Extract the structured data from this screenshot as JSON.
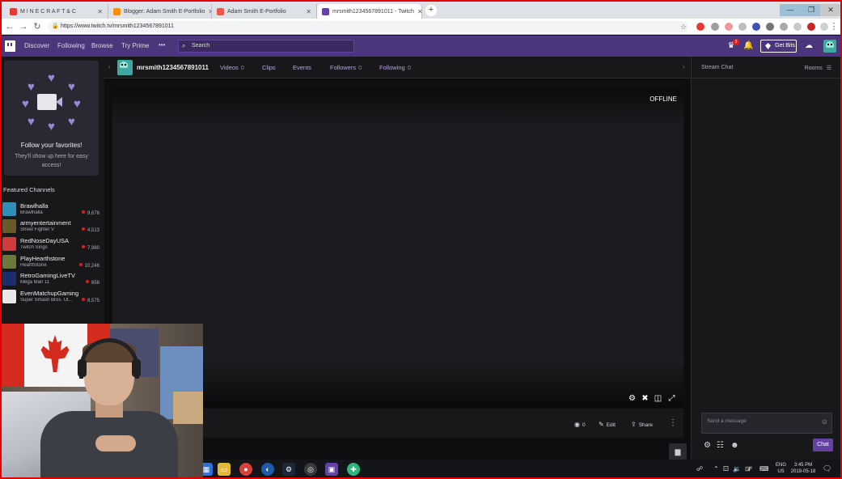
{
  "browser": {
    "tabs": [
      {
        "title": "M I N E C R A F T  &  C",
        "favicon_color": "#e53935",
        "active": false
      },
      {
        "title": "Blogger: Adam Smith E-Portfolio",
        "favicon_color": "#ff8f00",
        "active": false
      },
      {
        "title": "Adam Smith E-Portfolio",
        "favicon_color": "#e8584b",
        "active": false
      },
      {
        "title": "mrsmith1234567891011 - Twitch",
        "favicon_color": "#6441a4",
        "active": true
      }
    ],
    "new_tab": "+",
    "url": "https://www.twitch.tv/mrsmith1234567891011"
  },
  "twitch_nav": {
    "links": [
      "Discover",
      "Following",
      "Browse",
      "Try Prime"
    ],
    "more": "•••",
    "search_placeholder": "Search",
    "notification_count": "2",
    "get_bits": "Get Bits",
    "brand_color": "#4b367c",
    "accent_color": "#6441a4"
  },
  "sidebar": {
    "follow_title": "Follow your favorites!",
    "follow_sub": "They'll show up here for easy access!",
    "featured_title": "Featured Channels",
    "channels": [
      {
        "name": "Brawlhalla",
        "game": "Brawlhalla",
        "viewers": "9,676",
        "color": "#2f8fb8"
      },
      {
        "name": "armyentertainment",
        "game": "Street Fighter V",
        "viewers": "4,513",
        "color": "#6a5a2a"
      },
      {
        "name": "RedNoseDayUSA",
        "game": "Twitch Sings",
        "viewers": "7,980",
        "color": "#d23b3b"
      },
      {
        "name": "PlayHearthstone",
        "game": "Hearthstone",
        "viewers": "10,246",
        "color": "#6a7a3a"
      },
      {
        "name": "RetroGamingLiveTV",
        "game": "Mega Man 11",
        "viewers": "658",
        "color": "#1c2d6e"
      },
      {
        "name": "EvenMatchupGaming",
        "game": "Super Smash Bros. Ul...",
        "viewers": "8,575",
        "color": "#e8e8e8"
      }
    ]
  },
  "channel": {
    "name": "mrsmith1234567891011",
    "tabs": [
      {
        "label": "Videos",
        "count": "0"
      },
      {
        "label": "Clips",
        "count": ""
      },
      {
        "label": "Events",
        "count": ""
      },
      {
        "label": "Followers",
        "count": "0"
      },
      {
        "label": "Following",
        "count": "0"
      }
    ]
  },
  "player": {
    "status": "OFFLINE",
    "viewer_count": "0",
    "edit_label": "Edit",
    "share_label": "Share"
  },
  "chat": {
    "title": "Stream Chat",
    "rooms_label": "Rooms",
    "input_placeholder": "Send a message",
    "chat_button": "Chat"
  },
  "taskbar": {
    "lang_top": "ENG",
    "lang_bottom": "US",
    "time": "3:45 PM",
    "date": "2019-05-18"
  }
}
